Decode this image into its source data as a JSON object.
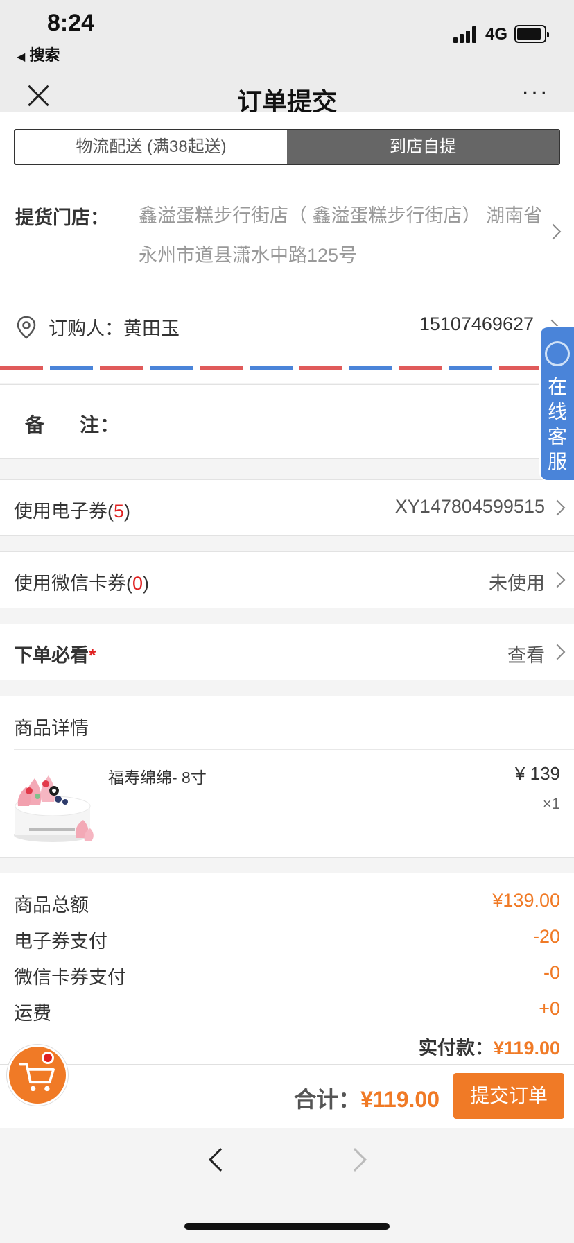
{
  "status_bar": {
    "time": "8:24",
    "back_label": "搜索",
    "network": "4G"
  },
  "nav": {
    "title": "订单提交"
  },
  "delivery_tabs": [
    {
      "label": "物流配送 (满38起送)",
      "active": false
    },
    {
      "label": "到店自提",
      "active": true
    }
  ],
  "pickup": {
    "store_label": "提货门店：",
    "store_text": "鑫溢蛋糕步行街店（ 鑫溢蛋糕步行街店） 湖南省永州市道县潇水中路125号",
    "buyer_label": "订购人：黄田玉",
    "phone": "15107469627"
  },
  "remark": {
    "label_a": "备",
    "label_b": "注："
  },
  "coupon": {
    "label": "使用电子券(",
    "count": "5",
    "close": ")",
    "value": "XY147804599515"
  },
  "wx_card": {
    "label": "使用微信卡券(",
    "count": "0",
    "close": ")",
    "value": "未使用"
  },
  "notice": {
    "label": "下单必看",
    "star": "*",
    "value": "查看"
  },
  "goods": {
    "title": "商品详情",
    "items": [
      {
        "name": "福寿绵绵- 8寸",
        "price": "¥ 139",
        "qty": "×1"
      }
    ]
  },
  "summary": {
    "rows": [
      {
        "k": "商品总额",
        "v": "¥139.00"
      },
      {
        "k": "电子券支付",
        "v": "-20"
      },
      {
        "k": "微信卡券支付",
        "v": "-0"
      },
      {
        "k": "运费",
        "v": "+0"
      }
    ],
    "paid_label": "实付款：",
    "paid_value": "¥119.00"
  },
  "footer": {
    "total_label": "合计：",
    "total_value": "¥119.00",
    "submit_label": "提交订单"
  },
  "customer_service": {
    "label": "在线客服"
  },
  "colors": {
    "accent": "#f07a26",
    "red": "#e02020",
    "blue": "#4a84d9"
  }
}
